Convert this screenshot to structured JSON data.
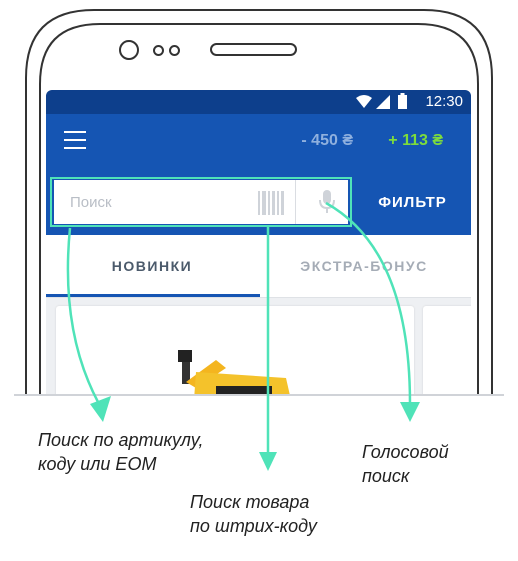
{
  "status_bar": {
    "time": "12:30"
  },
  "app_bar": {
    "balance_negative": "- 450 ₴",
    "balance_positive": "+ 113 ₴"
  },
  "search": {
    "placeholder": "Поиск",
    "filter_label": "ФИЛЬТР"
  },
  "tabs": [
    {
      "label": "НОВИНКИ",
      "active": true
    },
    {
      "label": "ЭКСТРА-БОНУС",
      "active": false
    }
  ],
  "callouts": {
    "article_search": "Поиск по артикулу,\nкоду или EOM",
    "barcode_search": "Поиск товара\nпо штрих-коду",
    "voice_search": "Голосовой\nпоиск"
  },
  "colors": {
    "appbar": "#1555b3",
    "statusbar": "#0d3f8c",
    "accent": "#4fe3b8",
    "positive": "#7ddc3c"
  },
  "icons": [
    "menu-icon",
    "wifi-icon",
    "signal-icon",
    "battery-icon",
    "barcode-icon",
    "mic-icon"
  ]
}
